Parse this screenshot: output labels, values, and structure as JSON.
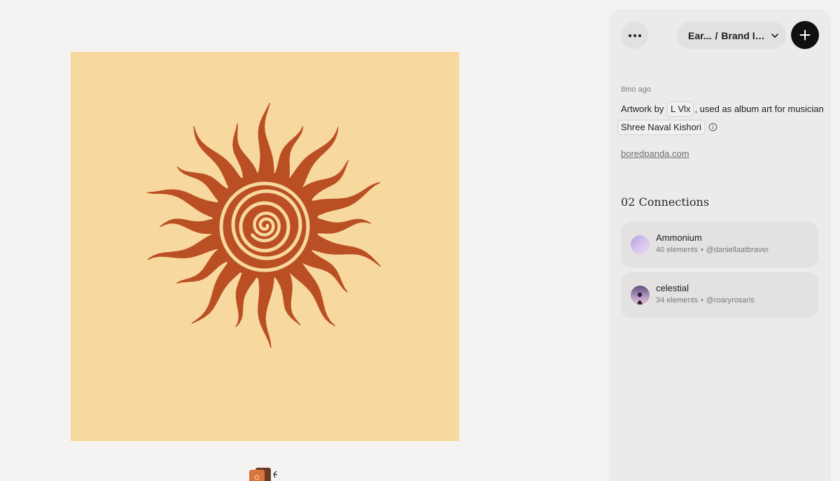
{
  "block": {
    "timestamp": "8mo ago",
    "description": {
      "prefix": "Artwork by",
      "artist": "L Vlx",
      "middle": ", used as album art for musician",
      "musician": "Shree Naval Kishori"
    },
    "source": "boredpanda.com"
  },
  "header": {
    "breadcrumb_channel": "Ear...",
    "breadcrumb_separator": "/",
    "breadcrumb_block": "Brand Ic...",
    "menu_icon": "more-horizontal-icon",
    "dropdown_icon": "chevron-down-icon",
    "add_icon": "plus-icon"
  },
  "connections": {
    "title": "02 Connections",
    "items": [
      {
        "name": "Ammonium",
        "count": "40 elements",
        "user": "@daniellaatbraver"
      },
      {
        "name": "celestial",
        "count": "34 elements",
        "user": "@roaryrosaris"
      }
    ]
  },
  "colors": {
    "artwork_background": "#f7d89e",
    "sun": "#bb4f24",
    "add_button": "#101010"
  }
}
